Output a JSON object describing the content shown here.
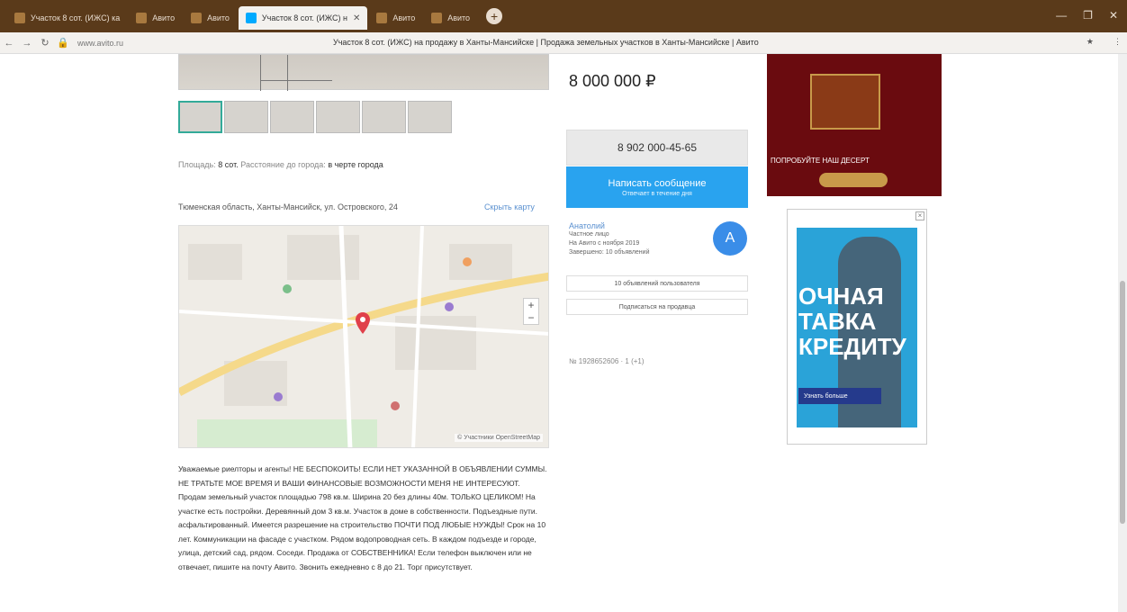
{
  "browser": {
    "tabs": [
      {
        "label": "Участок 8 сот. (ИЖС) ка",
        "active": false
      },
      {
        "label": "Авито",
        "active": false
      },
      {
        "label": "Авито",
        "active": false
      },
      {
        "label": "Участок 8 сот. (ИЖС) н",
        "active": true
      },
      {
        "label": "Авито",
        "active": false
      },
      {
        "label": "Авито",
        "active": false
      }
    ],
    "new_tab_label": "+",
    "window_controls": [
      "—",
      "❐",
      "✕"
    ],
    "url_domain": "www.avito.ru",
    "page_title": "Участок 8 сот. (ИЖС) на продажу в Ханты-Мансийске | Продажа земельных участков в Ханты-Мансийске | Авито",
    "right_items": [
      "★",
      "⋮"
    ]
  },
  "listing": {
    "params_label": "Площадь:",
    "params_value": "8 сот.",
    "params_suffix": "Расстояние до города:",
    "params_suffix_value": "в черте города",
    "address": "Тюменская область, Ханты-Мансийск, ул. Островского, 24",
    "show_map": "Скрыть карту",
    "map_copyright": "© Участники OpenStreetMap",
    "zoom_in": "+",
    "zoom_out": "−",
    "description": "Уважаемые риелторы и агенты! НЕ БЕСПОКОИТЬ! ЕСЛИ НЕТ УКАЗАННОЙ В ОБЪЯВЛЕНИИ СУММЫ. НЕ ТРАТЬТЕ МОЕ ВРЕМЯ И ВАШИ ФИНАНСОВЫЕ ВОЗМОЖНОСТИ МЕНЯ НЕ ИНТЕРЕСУЮТ. Продам земельный участок площадью 798 кв.м. Ширина 20 без длины 40м. ТОЛЬКО ЦЕЛИКОМ! На участке есть постройки. Деревянный дом 3 кв.м. Участок в доме в собственности. Подъездные пути. асфальтированный. Имеется разрешение на строительство ПОЧТИ ПОД ЛЮБЫЕ НУЖДЫ! Срок на 10 лет. Коммуникации на фасаде с участком. Рядом водопроводная сеть. В каждом подъезде и городе, улица, детский сад, рядом. Соседи. Продажа от СОБСТВЕННИКА! Если телефон выключен или не отвечает, пишите на почту Авито. Звонить ежедневно с 8 до 21. Торг присутствует."
  },
  "sidebar": {
    "price": "8 000 000 ₽",
    "phone": "8 902 000-45-65",
    "message_title": "Написать сообщение",
    "message_sub": "Отвечает в течение дня",
    "seller_name": "Анатолий",
    "seller_type": "Частное лицо",
    "seller_since": "На Авито с ноября 2019",
    "seller_ads": "Завершено: 10 объявлений",
    "avatar_letter": "А",
    "btn_other_ads": "10 объявлений пользователя",
    "btn_subscribe": "Подписаться на продавца",
    "ad_id": "№ 1928652606 · 1 (+1)"
  },
  "ads": {
    "banner1_text": "ПОПРОБУЙТЕ НАШ ДЕСЕРТ",
    "banner2_text": "ОЧНАЯ\nТАВКА\nКРЕДИТУ",
    "banner2_cta": "Узнать больше"
  },
  "colors": {
    "accent": "#29a3ef",
    "link": "#5a90d0",
    "tabbar": "#5a3a1a"
  }
}
